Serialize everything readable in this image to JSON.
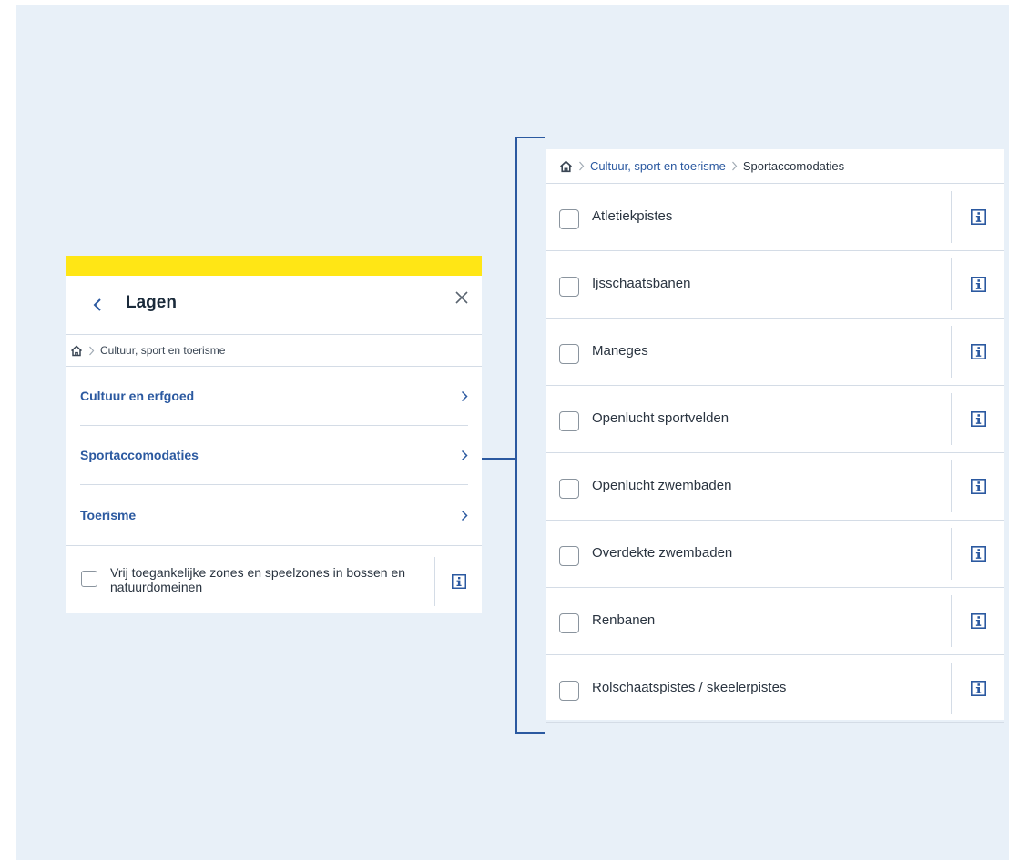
{
  "left_panel": {
    "title": "Lagen",
    "breadcrumb": {
      "current": "Cultuur, sport en toerisme"
    },
    "categories": [
      {
        "label": "Cultuur en erfgoed"
      },
      {
        "label": "Sportaccomodaties"
      },
      {
        "label": "Toerisme"
      }
    ],
    "layer": {
      "label": "Vrij toegankelijke zones en speelzones in bossen en natuurdomeinen",
      "checked": false
    }
  },
  "right_panel": {
    "breadcrumb": {
      "parent": "Cultuur, sport en toerisme",
      "current": "Sportaccomodaties"
    },
    "layers": [
      {
        "label": "Atletiekpistes",
        "checked": false
      },
      {
        "label": "Ijsschaatsbanen",
        "checked": false
      },
      {
        "label": "Maneges",
        "checked": false
      },
      {
        "label": "Openlucht sportvelden",
        "checked": false
      },
      {
        "label": "Openlucht zwembaden",
        "checked": false
      },
      {
        "label": "Overdekte zwembaden",
        "checked": false
      },
      {
        "label": "Renbanen",
        "checked": false
      },
      {
        "label": "Rolschaatspistes / skeelerpistes",
        "checked": false
      }
    ]
  },
  "colors": {
    "accent_yellow": "#ffe615",
    "link_blue": "#2b59a0",
    "background": "#e8f0f8"
  },
  "icons": [
    "home-icon",
    "chevron-left-icon",
    "chevron-right-icon",
    "close-icon",
    "info-icon"
  ]
}
